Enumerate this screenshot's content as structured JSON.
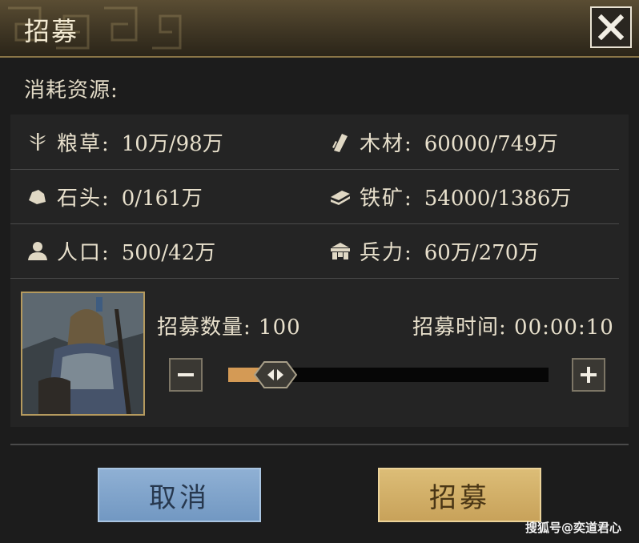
{
  "dialog": {
    "title": "招募",
    "close_icon": "close-icon"
  },
  "cost_label": "消耗资源:",
  "resources": [
    {
      "icon": "grain-icon",
      "name": "粮草:",
      "value": "10万/98万"
    },
    {
      "icon": "wood-icon",
      "name": "木材:",
      "value": "60000/749万"
    },
    {
      "icon": "stone-icon",
      "name": "石头:",
      "value": "0/161万"
    },
    {
      "icon": "iron-ore-icon",
      "name": "铁矿:",
      "value": "54000/1386万"
    },
    {
      "icon": "population-icon",
      "name": "人口:",
      "value": "500/42万"
    },
    {
      "icon": "troops-icon",
      "name": "兵力:",
      "value": "60万/270万"
    }
  ],
  "recruit": {
    "quantity_label": "招募数量:",
    "quantity_value": "100",
    "time_label": "招募时间:",
    "time_value": "00:00:10",
    "slider_fraction": 0.1
  },
  "buttons": {
    "cancel_label": "取消",
    "recruit_label": "招募"
  },
  "watermark": "搜狐号@奕道君心",
  "colors": {
    "gold_accent": "#c8a25a",
    "cancel_blue": "#7298c2",
    "slider_fill": "#d49a55"
  }
}
